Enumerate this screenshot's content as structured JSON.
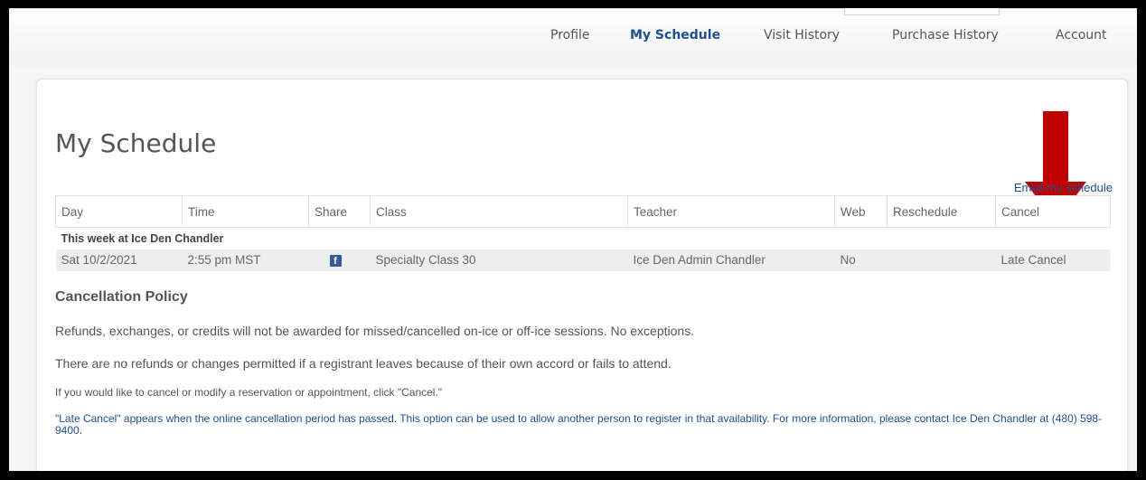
{
  "nav": {
    "items": [
      {
        "label": "Profile",
        "active": false
      },
      {
        "label": "My Schedule",
        "active": true
      },
      {
        "label": "Visit History",
        "active": false
      },
      {
        "label": "Purchase History",
        "active": false
      },
      {
        "label": "Account",
        "active": false
      }
    ]
  },
  "page": {
    "title": "My Schedule",
    "email_link": "Email my schedule"
  },
  "annotation": {
    "color": "#c00000"
  },
  "table": {
    "headers": [
      "Day",
      "Time",
      "Share",
      "Class",
      "Teacher",
      "Web",
      "Reschedule",
      "Cancel"
    ],
    "section_label": "This week at Ice Den Chandler",
    "rows": [
      {
        "day": "Sat 10/2/2021",
        "time": "2:55 pm MST",
        "share_icon": "facebook-icon",
        "class": "Specialty Class 30",
        "teacher": "Ice Den Admin Chandler",
        "web": "No",
        "reschedule": "",
        "cancel": "Late Cancel"
      }
    ]
  },
  "policy": {
    "heading": "Cancellation Policy",
    "line1": "Refunds, exchanges, or credits will not be awarded for missed/cancelled on-ice or off-ice sessions. No exceptions.",
    "line2": "There are no refunds or changes permitted if a registrant leaves because of their own accord or fails to attend.",
    "line3": "If you would like to cancel or modify a reservation or appointment, click \"Cancel.\"",
    "line4": "\"Late Cancel\" appears when the online cancellation period has passed. This option can be used to allow another person to register in that availability. For more information, please contact Ice Den Chandler at (480) 598-9400."
  },
  "colors": {
    "link": "#1d4f8f",
    "text": "#555555",
    "facebook": "#3b5998"
  }
}
